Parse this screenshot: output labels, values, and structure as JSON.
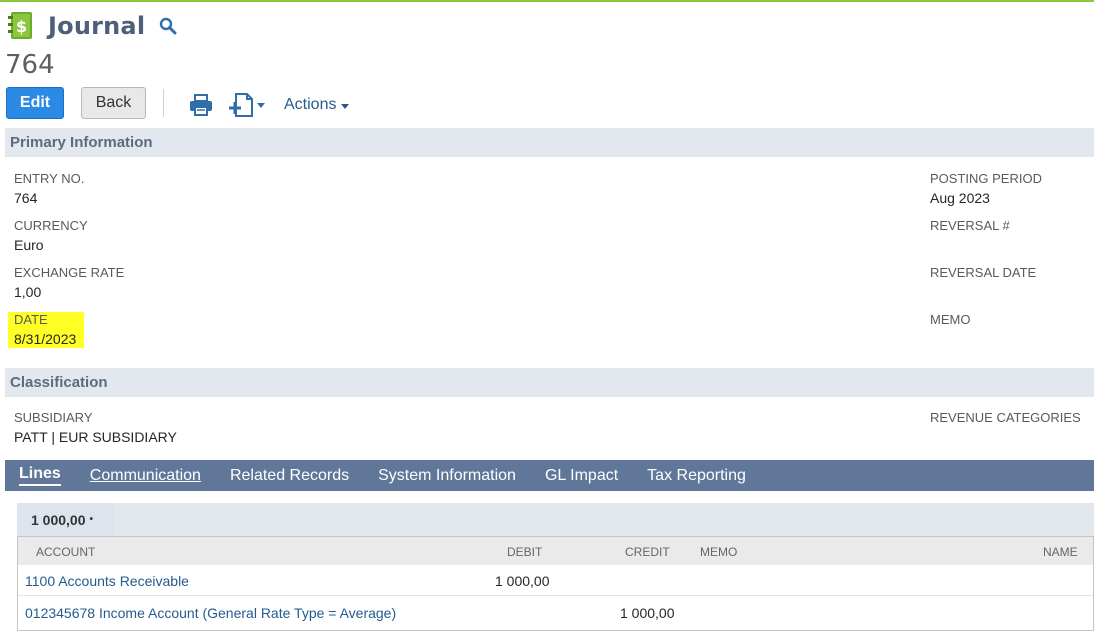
{
  "page": {
    "title": "Journal",
    "record_number": "764"
  },
  "toolbar": {
    "edit_label": "Edit",
    "back_label": "Back",
    "actions_label": "Actions"
  },
  "primary": {
    "header": "Primary Information",
    "fields": {
      "entry_no": {
        "label": "ENTRY NO.",
        "value": "764"
      },
      "currency": {
        "label": "CURRENCY",
        "value": "Euro"
      },
      "exchange_rate": {
        "label": "EXCHANGE RATE",
        "value": "1,00"
      },
      "date": {
        "label": "DATE",
        "value": "8/31/2023"
      },
      "posting_period": {
        "label": "POSTING PERIOD",
        "value": "Aug 2023"
      },
      "reversal_no": {
        "label": "REVERSAL #",
        "value": ""
      },
      "reversal_date": {
        "label": "REVERSAL DATE",
        "value": ""
      },
      "memo": {
        "label": "MEMO",
        "value": ""
      }
    }
  },
  "classification": {
    "header": "Classification",
    "subsidiary": {
      "label": "SUBSIDIARY",
      "value": "PATT | EUR SUBSIDIARY"
    },
    "revenue_categories": {
      "label": "REVENUE CATEGORIES",
      "value": ""
    }
  },
  "tabs": [
    {
      "label": "Lines",
      "active": true
    },
    {
      "label": "Communication",
      "active": false
    },
    {
      "label": "Related Records",
      "active": false
    },
    {
      "label": "System Information",
      "active": false
    },
    {
      "label": "GL Impact",
      "active": false
    },
    {
      "label": "Tax Reporting",
      "active": false
    }
  ],
  "lines": {
    "subtab_label": "1 000,00",
    "columns": [
      "ACCOUNT",
      "DEBIT",
      "CREDIT",
      "MEMO",
      "NAME"
    ],
    "rows": [
      {
        "account": "1100 Accounts Receivable",
        "debit": "1 000,00",
        "credit": "",
        "memo": "",
        "name": ""
      },
      {
        "account": "012345678 Income Account (General Rate Type = Average)",
        "debit": "",
        "credit": "1 000,00",
        "memo": "",
        "name": ""
      }
    ]
  },
  "colors": {
    "accent": "#2b8ae6",
    "tabbar": "#607799",
    "section": "#e3e8ef",
    "highlight": "#ffff26",
    "top_line": "#8cc63f"
  }
}
